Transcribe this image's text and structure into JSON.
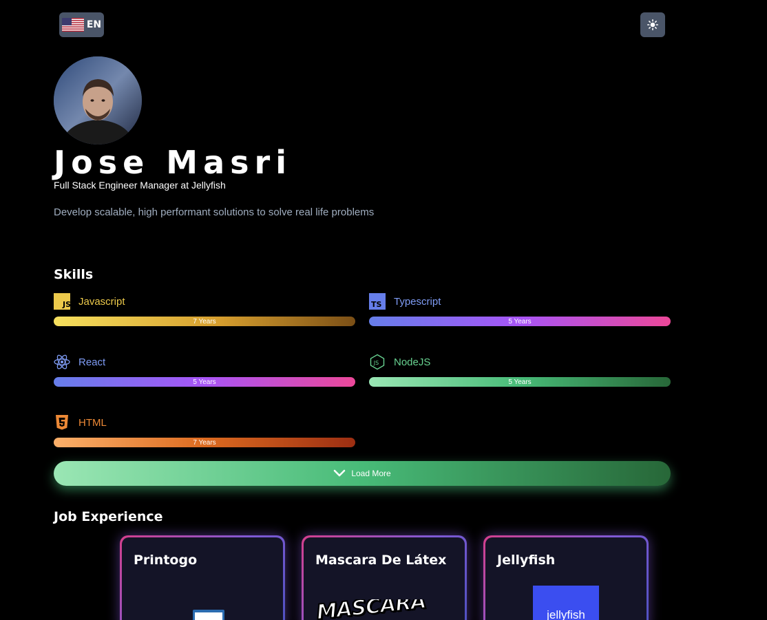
{
  "header": {
    "language_label": "EN",
    "language_flag_icon": "us-flag-icon",
    "theme_toggle_icon": "sun-icon"
  },
  "profile": {
    "name": "Jose Masri",
    "role": "Full Stack Engineer Manager at Jellyfish",
    "tagline": "Develop scalable, high performant solutions to solve real life problems"
  },
  "skills": {
    "title": "Skills",
    "items": [
      {
        "name": "Javascript",
        "years": "7 Years",
        "icon": "javascript-icon",
        "color": "#ecc94b"
      },
      {
        "name": "Typescript",
        "years": "5 Years",
        "icon": "typescript-icon",
        "color": "#667eea"
      },
      {
        "name": "React",
        "years": "5 Years",
        "icon": "react-icon",
        "color": "#667eea"
      },
      {
        "name": "NodeJS",
        "years": "5 Years",
        "icon": "nodejs-icon",
        "color": "#68d391"
      },
      {
        "name": "HTML",
        "years": "7 Years",
        "icon": "html5-icon",
        "color": "#ed8936"
      }
    ],
    "load_more_label": "Load More"
  },
  "experience": {
    "title": "Job Experience",
    "jobs": [
      {
        "company": "Printogo"
      },
      {
        "company": "Mascara De Látex",
        "logo_text": "MASCARA"
      },
      {
        "company": "Jellyfish",
        "logo_text": "jellyfish"
      }
    ]
  }
}
